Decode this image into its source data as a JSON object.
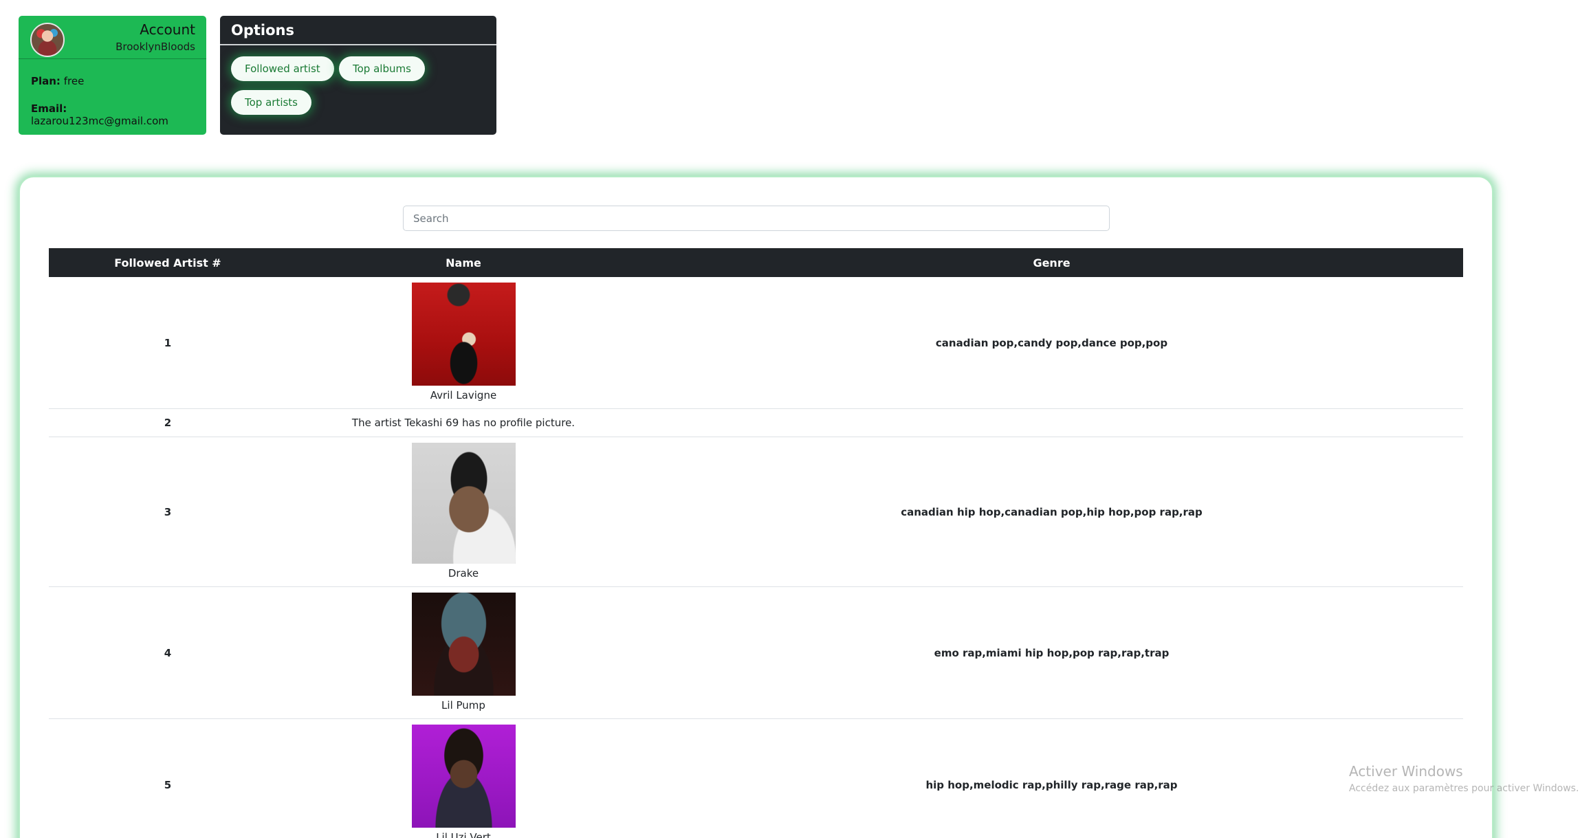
{
  "account": {
    "title": "Account",
    "username": "BrooklynBloods",
    "plan_label": "Plan:",
    "plan_value": "free",
    "email_label": "Email:",
    "email_value": "lazarou123mc@gmail.com"
  },
  "options": {
    "title": "Options",
    "buttons": [
      {
        "label": "Followed artist"
      },
      {
        "label": "Top albums"
      },
      {
        "label": "Top artists"
      }
    ]
  },
  "search": {
    "placeholder": "Search",
    "value": ""
  },
  "table": {
    "headers": [
      "Followed Artist #",
      "Name",
      "Genre"
    ],
    "rows": [
      {
        "num": "1",
        "name": "Avril Lavigne",
        "genre": "canadian pop,candy pop,dance pop,pop",
        "has_picture": true
      },
      {
        "num": "2",
        "name": "",
        "no_picture_text": "The artist Tekashi 69 has no profile picture.",
        "genre": "",
        "has_picture": false
      },
      {
        "num": "3",
        "name": "Drake",
        "genre": "canadian hip hop,canadian pop,hip hop,pop rap,rap",
        "has_picture": true
      },
      {
        "num": "4",
        "name": "Lil Pump",
        "genre": "emo rap,miami hip hop,pop rap,rap,trap",
        "has_picture": true
      },
      {
        "num": "5",
        "name": "Lil Uzi Vert",
        "genre": "hip hop,melodic rap,philly rap,rage rap,rap",
        "has_picture": true
      }
    ]
  },
  "watermark": {
    "title": "Activer Windows",
    "subtitle": "Accédez aux paramètres pour activer Windows."
  },
  "colors": {
    "accent": "#1db954",
    "dark": "#212529"
  }
}
